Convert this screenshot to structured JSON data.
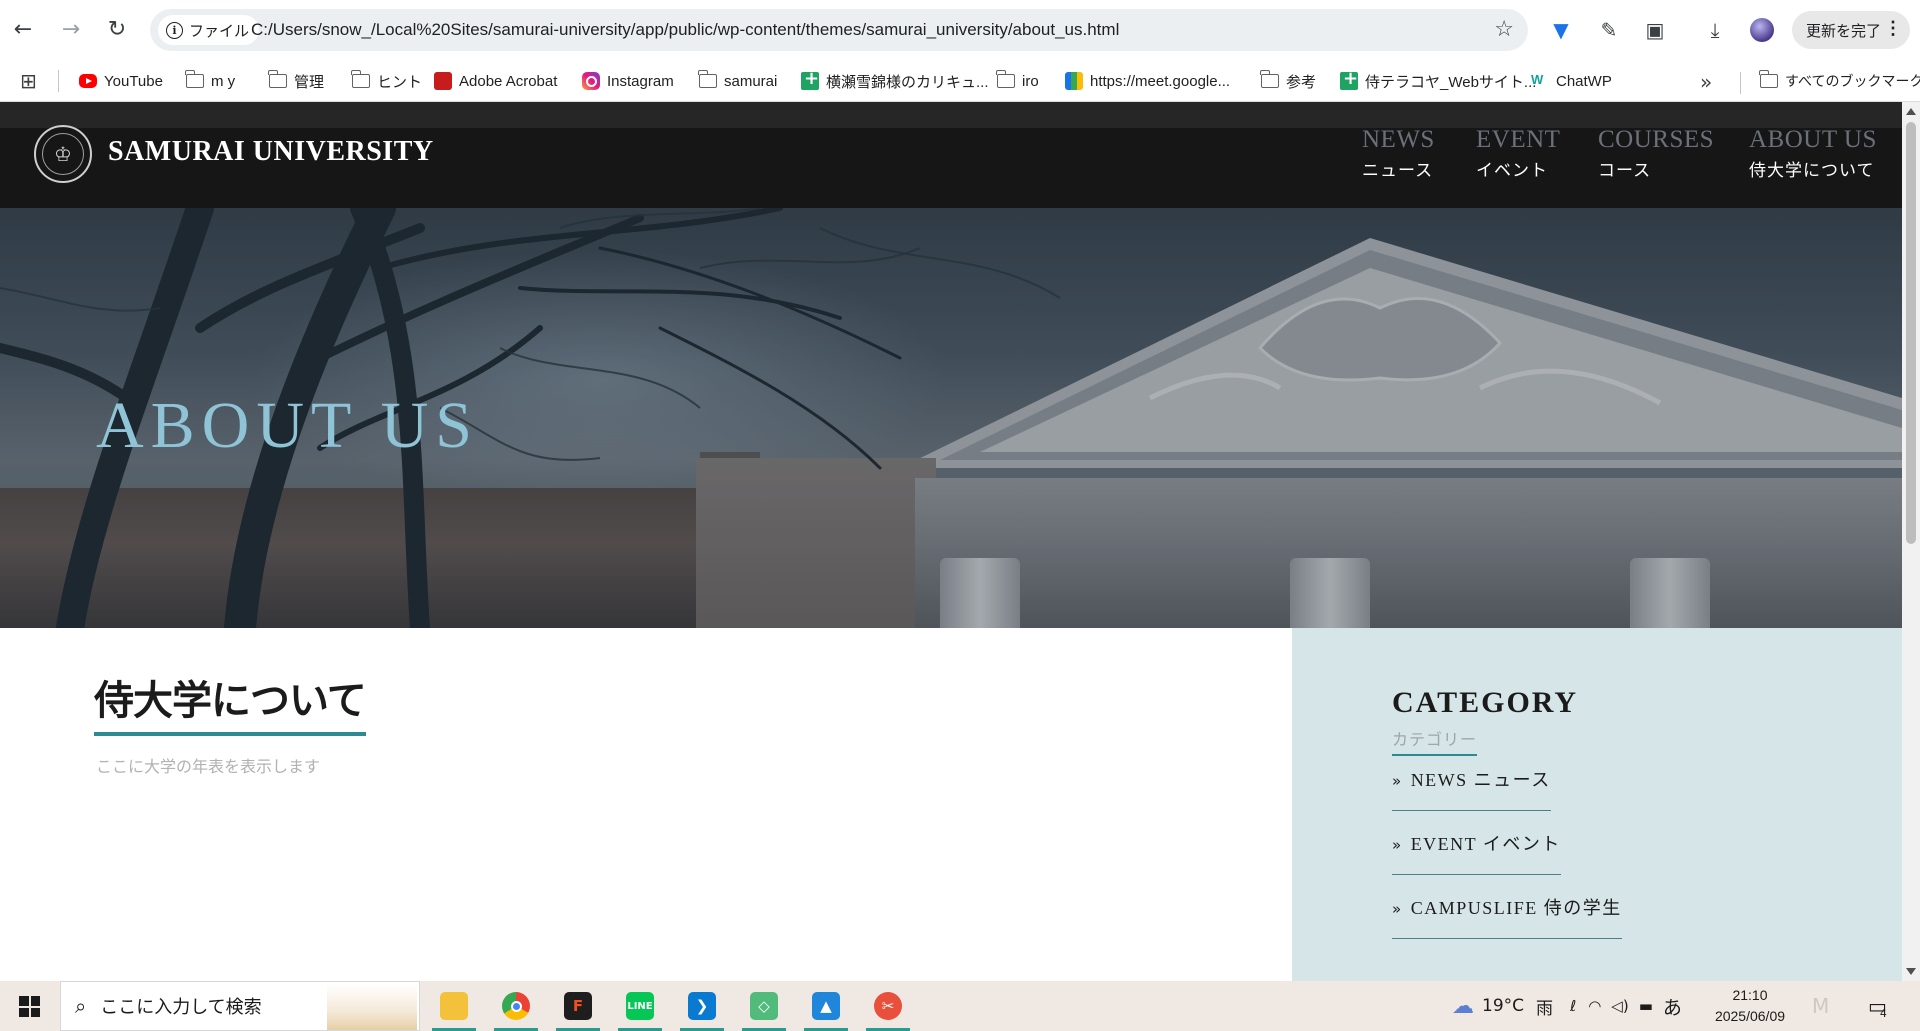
{
  "browser": {
    "back_icon": "arrow-left-icon",
    "forward_icon": "arrow-right-icon",
    "reload_icon": "reload-icon",
    "info_chip_label": "ファイル",
    "url": "C:/Users/snow_/Local%20Sites/samurai-university/app/public/wp-content/themes/samurai_university/about_us.html",
    "update_button_label": "更新を完了"
  },
  "bookmarks": {
    "items": [
      {
        "label": "YouTube",
        "icon": "youtube-icon"
      },
      {
        "label": "m y",
        "icon": "folder-icon"
      },
      {
        "label": "管理",
        "icon": "folder-icon"
      },
      {
        "label": "ヒント",
        "icon": "folder-icon"
      },
      {
        "label": "Adobe Acrobat",
        "icon": "acrobat-icon"
      },
      {
        "label": "Instagram",
        "icon": "instagram-icon"
      },
      {
        "label": "samurai",
        "icon": "folder-icon"
      },
      {
        "label": "横瀬雪錦様のカリキュ...",
        "icon": "sheets-icon"
      },
      {
        "label": "iro",
        "icon": "folder-icon"
      },
      {
        "label": "https://meet.google...",
        "icon": "meet-icon"
      },
      {
        "label": "参考",
        "icon": "folder-icon"
      },
      {
        "label": "侍テラコヤ_Webサイト...",
        "icon": "sheets-icon"
      },
      {
        "label": "ChatWP",
        "icon": "wp-icon"
      }
    ],
    "all_bookmarks_label": "すべてのブックマーク"
  },
  "site": {
    "title": "SAMURAI UNIVERSITY",
    "nav": [
      {
        "en": "NEWS",
        "ja": "ニュース"
      },
      {
        "en": "EVENT",
        "ja": "イベント"
      },
      {
        "en": "COURSES",
        "ja": "コース"
      },
      {
        "en": "ABOUT US",
        "ja": "侍大学について"
      }
    ],
    "hero_title": "ABOUT US",
    "page_heading": "侍大学について",
    "page_body": "ここに大学の年表を表示します",
    "sidebar": {
      "title": "CATEGORY",
      "subtitle": "カテゴリー",
      "items": [
        "NEWS ニュース",
        "EVENT イベント",
        "CAMPUSLIFE 侍の学生"
      ]
    }
  },
  "taskbar": {
    "search_placeholder": "ここに入力して検索",
    "weather": "19°C",
    "weather_desc": "雨",
    "ime": "あ",
    "time": "21:10",
    "date": "2025/06/09",
    "notification_count": "4"
  }
}
